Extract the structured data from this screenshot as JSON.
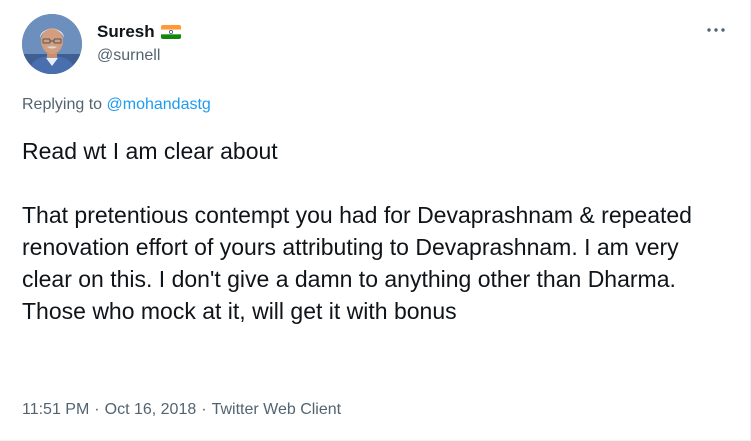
{
  "author": {
    "name": "Suresh",
    "handle": "@surnell",
    "flag_icon": "india-flag-icon",
    "avatar_icon": "profile-photo"
  },
  "more_icon": "more-options-icon",
  "reply": {
    "prefix": "Replying to",
    "mention": "@mohandastg"
  },
  "body": {
    "paragraph_1": "Read wt I am clear about",
    "paragraph_2": "That pretentious contempt you had for Devaprashnam & repeated renovation effort of yours attributing to Devaprashnam. I am very clear on this. I don't give a damn to anything other than Dharma. Those who mock at it, will get it with bonus"
  },
  "meta": {
    "time": "11:51 PM",
    "separator_1": "·",
    "date": "Oct 16, 2018",
    "separator_2": "·",
    "source": "Twitter Web Client"
  },
  "colors": {
    "text": "#0f1419",
    "secondary": "#536471",
    "link": "#1d9bf0"
  }
}
